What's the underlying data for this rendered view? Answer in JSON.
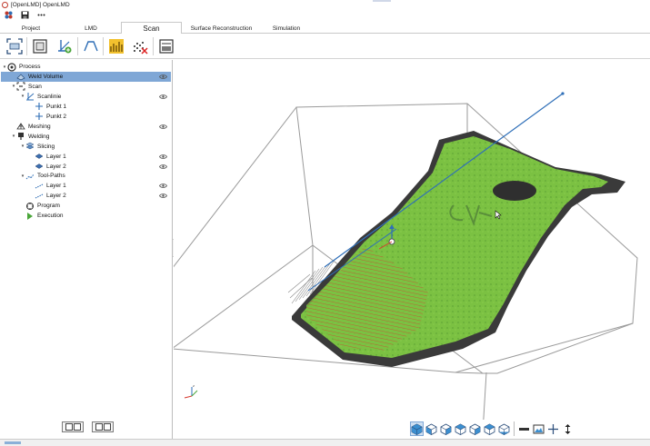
{
  "window": {
    "title": "[OpenLMD] OpenLMD"
  },
  "quick_access": [
    {
      "icon": "app-menu-icon"
    },
    {
      "icon": "save-icon"
    },
    {
      "icon": "more-icon"
    }
  ],
  "tabs": [
    {
      "label": "Project",
      "active": false
    },
    {
      "label": "LMD",
      "active": false
    },
    {
      "label": "Scan",
      "active": true
    },
    {
      "label": "Surface Reconstruction",
      "active": false
    },
    {
      "label": "Simulation",
      "active": false
    }
  ],
  "ribbon_tools": [
    {
      "icon": "scan-frame-icon"
    },
    {
      "icon": "import-scan-icon"
    },
    {
      "icon": "add-scanline-icon"
    },
    {
      "icon": "trapezoid-profile-icon"
    },
    {
      "icon": "pointcloud-filter-icon"
    },
    {
      "icon": "remove-points-icon"
    },
    {
      "icon": "flatten-icon"
    }
  ],
  "tree": [
    {
      "label": "Process",
      "level": 0,
      "expanded": true,
      "icon": "process-icon",
      "eye": false,
      "selected": false
    },
    {
      "label": "Weld Volume",
      "level": 1,
      "icon": "volume-icon",
      "eye": true,
      "selected": true
    },
    {
      "label": "Scan",
      "level": 1,
      "expanded": true,
      "icon": "scan-icon",
      "eye": false,
      "selected": false
    },
    {
      "label": "Scanlinie",
      "level": 2,
      "expanded": true,
      "icon": "scanline-icon",
      "eye": true,
      "selected": false
    },
    {
      "label": "Punkt 1",
      "level": 3,
      "icon": "point-icon",
      "eye": false,
      "selected": false
    },
    {
      "label": "Punkt 2",
      "level": 3,
      "icon": "point-icon",
      "eye": false,
      "selected": false
    },
    {
      "label": "Meshing",
      "level": 1,
      "icon": "mesh-icon",
      "eye": true,
      "selected": false
    },
    {
      "label": "Welding",
      "level": 1,
      "expanded": true,
      "icon": "welding-icon",
      "eye": false,
      "selected": false
    },
    {
      "label": "Slicing",
      "level": 2,
      "expanded": true,
      "icon": "slicing-icon",
      "eye": false,
      "selected": false
    },
    {
      "label": "Layer 1",
      "level": 3,
      "icon": "layer-icon",
      "eye": true,
      "selected": false
    },
    {
      "label": "Layer 2",
      "level": 3,
      "icon": "layer-icon",
      "eye": true,
      "selected": false
    },
    {
      "label": "Tool-Paths",
      "level": 2,
      "expanded": true,
      "icon": "toolpath-icon",
      "eye": false,
      "selected": false
    },
    {
      "label": "Layer 1",
      "level": 3,
      "icon": "path-layer-icon",
      "eye": true,
      "selected": false
    },
    {
      "label": "Layer 2",
      "level": 3,
      "icon": "path-layer-icon",
      "eye": true,
      "selected": false
    },
    {
      "label": "Program",
      "level": 2,
      "icon": "program-icon",
      "eye": false,
      "selected": false
    },
    {
      "label": "Execution",
      "level": 2,
      "icon": "execution-icon",
      "eye": false,
      "selected": false
    }
  ],
  "tree_footer": [
    {
      "icon": "expand-all-icon"
    },
    {
      "icon": "collapse-all-icon"
    }
  ],
  "view_tools": [
    {
      "icon": "view-iso-icon",
      "active": true
    },
    {
      "icon": "view-front-icon"
    },
    {
      "icon": "view-back-icon"
    },
    {
      "icon": "view-left-icon"
    },
    {
      "icon": "view-right-icon"
    },
    {
      "icon": "view-top-icon"
    },
    {
      "icon": "view-bottom-icon"
    },
    {
      "icon": "measure-icon"
    },
    {
      "icon": "screenshot-icon"
    },
    {
      "icon": "pan-icon"
    },
    {
      "icon": "zoom-fit-icon"
    }
  ],
  "colors": {
    "accent_tree_selection": "#7fa7d6",
    "scan_surface": "#7bc142",
    "scan_edge": "#3a3a3a",
    "scan_line": "#2f6fb8",
    "toolpath": "#d63a2f"
  }
}
